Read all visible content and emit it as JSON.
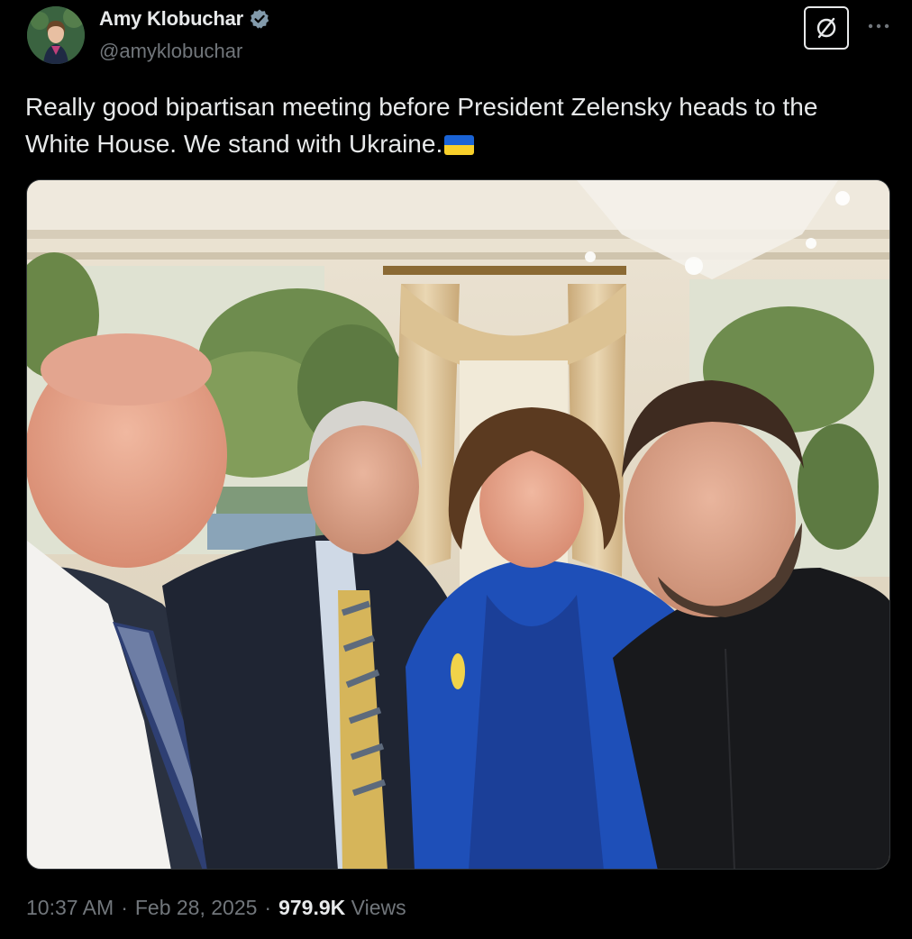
{
  "author": {
    "display_name": "Amy Klobuchar",
    "handle": "@amyklobuchar",
    "verified": true,
    "verified_color": "#829aab"
  },
  "tweet": {
    "text": "Really good bipartisan meeting before President Zelensky heads to the White House. We stand with Ukraine.",
    "flag_icon": "ukraine-flag-emoji"
  },
  "meta": {
    "time": "10:37 AM",
    "separator": "·",
    "date": "Feb 28, 2025",
    "views_count": "979.9K",
    "views_label": "Views"
  },
  "icons": {
    "grok": "grok-icon",
    "more": "more-icon"
  },
  "colors": {
    "background": "#000000",
    "text_primary": "#e7e9ea",
    "text_secondary": "#71767b",
    "border": "#2f3336"
  }
}
